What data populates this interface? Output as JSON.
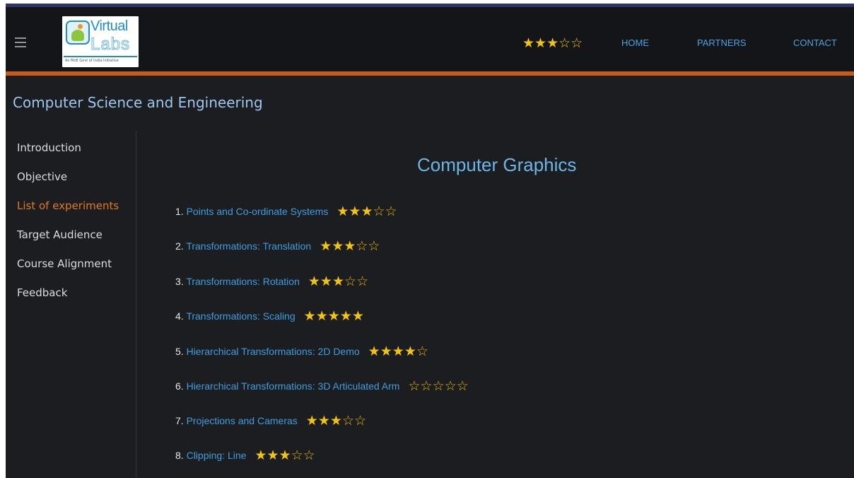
{
  "navbar": {
    "logo": {
      "line1": "Virtual",
      "line2": "Labs",
      "tagline": "An MoE Govt of India Initiative"
    },
    "rating": "★★★☆☆",
    "links": [
      "HOME",
      "PARTNERS",
      "CONTACT"
    ]
  },
  "section_title": "Computer Science and Engineering",
  "sidebar": {
    "items": [
      {
        "label": "Introduction"
      },
      {
        "label": "Objective"
      },
      {
        "label": "List of experiments"
      },
      {
        "label": "Target Audience"
      },
      {
        "label": "Course Alignment"
      },
      {
        "label": "Feedback"
      }
    ]
  },
  "main": {
    "title": "Computer Graphics",
    "experiments": [
      {
        "number": "1.",
        "title": "Points and Co-ordinate Systems",
        "rating": 3
      },
      {
        "number": "2.",
        "title": "Transformations: Translation",
        "rating": 3
      },
      {
        "number": "3.",
        "title": "Transformations: Rotation",
        "rating": 3
      },
      {
        "number": "4.",
        "title": "Transformations: Scaling",
        "rating": 5
      },
      {
        "number": "5.",
        "title": "Hierarchical Transformations: 2D Demo",
        "rating": 4
      },
      {
        "number": "6.",
        "title": "Hierarchical Transformations: 3D Articulated Arm",
        "rating": 0
      },
      {
        "number": "7.",
        "title": "Projections and Cameras",
        "rating": 3
      },
      {
        "number": "8.",
        "title": "Clipping: Line",
        "rating": 3
      }
    ]
  },
  "colors": {
    "accent": "#c95a16",
    "link": "#3e9ee0",
    "active": "#e07a1f",
    "star": "#f2c30f"
  }
}
